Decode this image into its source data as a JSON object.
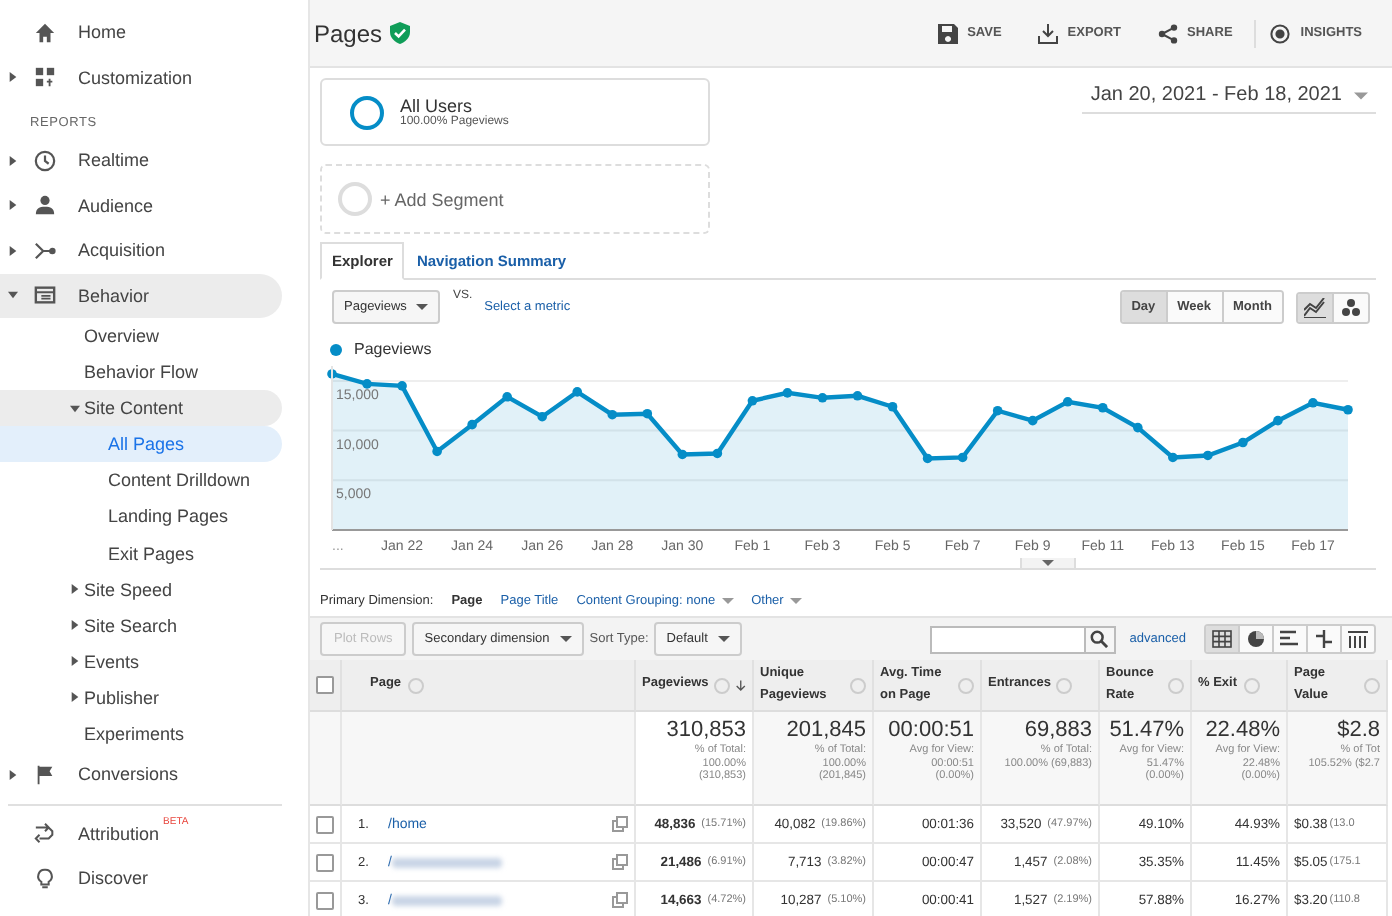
{
  "sidebar": {
    "top_items": [
      {
        "label": "Home",
        "kind": "home",
        "selected": false
      },
      {
        "label": "Customization",
        "kind": "dashboard",
        "expanded": false,
        "selected": false
      }
    ],
    "section_title": "REPORTS",
    "items": [
      {
        "label": "Realtime",
        "kind": "clock",
        "expanded": false,
        "selected": false
      },
      {
        "label": "Audience",
        "kind": "person",
        "expanded": false,
        "selected": false
      },
      {
        "label": "Acquisition",
        "kind": "branch",
        "expanded": false,
        "selected": false
      },
      {
        "label": "Behavior",
        "kind": "window",
        "expanded": true,
        "selected": false,
        "children": [
          {
            "label": "Overview",
            "selected": false
          },
          {
            "label": "Behavior Flow",
            "selected": false
          },
          {
            "label": "Site Content",
            "expanded": true,
            "selected": false,
            "children": [
              {
                "label": "All Pages",
                "selected": true
              },
              {
                "label": "Content Drilldown",
                "selected": false
              },
              {
                "label": "Landing Pages",
                "selected": false
              },
              {
                "label": "Exit Pages",
                "selected": false
              }
            ]
          },
          {
            "label": "Site Speed",
            "expanded": false,
            "selected": false
          },
          {
            "label": "Site Search",
            "expanded": false,
            "selected": false
          },
          {
            "label": "Events",
            "expanded": false,
            "selected": false
          },
          {
            "label": "Publisher",
            "expanded": false,
            "selected": false
          },
          {
            "label": "Experiments",
            "selected": false
          }
        ]
      },
      {
        "label": "Conversions",
        "kind": "flag",
        "expanded": false,
        "selected": false
      }
    ],
    "bottom_items": [
      {
        "label": "Attribution",
        "kind": "attribution",
        "badge": "BETA",
        "selected": false
      },
      {
        "label": "Discover",
        "kind": "bulb",
        "selected": false
      }
    ]
  },
  "header": {
    "title": "Pages",
    "actions": [
      {
        "label": "SAVE",
        "kind": "save"
      },
      {
        "label": "EXPORT",
        "kind": "export"
      },
      {
        "label": "SHARE",
        "kind": "share"
      },
      {
        "label": "INSIGHTS",
        "kind": "insights"
      }
    ]
  },
  "segments": [
    {
      "name": "All Users",
      "detail": "100.00% Pageviews"
    }
  ],
  "add_segment": "+ Add Segment",
  "date_range": "Jan 20, 2021 - Feb 18, 2021",
  "tabs": [
    {
      "label": "Explorer",
      "selected": true
    },
    {
      "label": "Navigation Summary",
      "selected": false
    }
  ],
  "metric_select": "Pageviews",
  "vs": "VS.",
  "select_metric": "Select a metric",
  "periods": [
    {
      "label": "Day",
      "selected": true
    },
    {
      "label": "Week",
      "selected": false
    },
    {
      "label": "Month",
      "selected": false
    }
  ],
  "chart_types": [
    {
      "kind": "line",
      "selected": true
    },
    {
      "kind": "motion",
      "selected": false
    }
  ],
  "chart": {
    "more": "...",
    "chart_data": {
      "type": "area",
      "grid": true,
      "categories": [
        null,
        null,
        "Jan 22",
        null,
        "Jan 24",
        null,
        "Jan 26",
        null,
        "Jan 28",
        null,
        "Jan 30",
        null,
        "Feb 1",
        null,
        "Feb 3",
        null,
        "Feb 5",
        null,
        "Feb 7",
        null,
        "Feb 9",
        null,
        "Feb 11",
        null,
        "Feb 13",
        null,
        "Feb 15",
        null,
        "Feb 17",
        null
      ],
      "series": [
        {
          "name": "Pageviews",
          "color": "#058dc7",
          "values": [
            15700,
            14700,
            14500,
            7900,
            10600,
            13400,
            11400,
            13900,
            11600,
            11700,
            7600,
            7700,
            13000,
            13800,
            13300,
            13500,
            12400,
            7200,
            7300,
            12000,
            11000,
            12900,
            12300,
            10300,
            7300,
            7500,
            8800,
            11000,
            12800,
            12100
          ]
        }
      ],
      "ylim": [
        0,
        16500
      ],
      "yticks": [
        {
          "value": 5000,
          "label": "5,000"
        },
        {
          "value": 10000,
          "label": "10,000"
        },
        {
          "value": 15000,
          "label": "15,000"
        }
      ]
    }
  },
  "primary_dimension": {
    "label": "Primary Dimension:",
    "options": [
      {
        "label": "Page",
        "selected": true,
        "dropdown": false
      },
      {
        "label": "Page Title",
        "selected": false,
        "dropdown": false
      },
      {
        "label": "Content Grouping: none",
        "selected": false,
        "dropdown": true
      },
      {
        "label": "Other",
        "selected": false,
        "dropdown": true
      }
    ]
  },
  "table_toolbar": {
    "plot_rows": {
      "label": "Plot Rows",
      "disabled": true
    },
    "secondary_dimension": "Secondary dimension",
    "sort_label": "Sort Type:",
    "sort_value": "Default",
    "advanced": "advanced",
    "views": [
      {
        "kind": "table",
        "selected": true
      },
      {
        "kind": "pie",
        "selected": false
      },
      {
        "kind": "bars",
        "selected": false
      },
      {
        "kind": "comparison",
        "selected": false
      },
      {
        "kind": "pivot",
        "selected": false
      }
    ]
  },
  "table": {
    "select_all_checked": false,
    "columns": [
      {
        "label": "Page",
        "sorted": false
      },
      {
        "label": "Pageviews",
        "sorted": true
      },
      {
        "label": "Unique Pageviews",
        "sorted": false
      },
      {
        "label": "Avg. Time on Page",
        "sorted": false
      },
      {
        "label": "Entrances",
        "sorted": false
      },
      {
        "label": "Bounce Rate",
        "sorted": false
      },
      {
        "label": "% Exit",
        "sorted": false
      },
      {
        "label": "Page Value",
        "sorted": false
      }
    ],
    "totals": [
      {
        "value": "310,853",
        "sub": [
          "% of Total:",
          "100.00%",
          "(310,853)"
        ]
      },
      {
        "value": "201,845",
        "sub": [
          "% of Total:",
          "100.00%",
          "(201,845)"
        ]
      },
      {
        "value": "00:00:51",
        "sub": [
          "Avg for View:",
          "00:00:51",
          "(0.00%)"
        ]
      },
      {
        "value": "69,883",
        "sub": [
          "% of Total:",
          "100.00% (69,883)"
        ]
      },
      {
        "value": "51.47%",
        "sub": [
          "Avg for View:",
          "51.47%",
          "(0.00%)"
        ]
      },
      {
        "value": "22.48%",
        "sub": [
          "Avg for View:",
          "22.48%",
          "(0.00%)"
        ]
      },
      {
        "value": "$2.8",
        "sub": [
          "% of Tot",
          "105.52% ($2.7"
        ]
      }
    ],
    "rows": [
      {
        "checked": false,
        "cells": [
          {
            "index": "1.",
            "value": "/home"
          },
          {
            "value": "48,836",
            "pct": "(15.71%)"
          },
          {
            "value": "40,082",
            "pct": "(19.86%)"
          },
          {
            "value": "00:01:36"
          },
          {
            "value": "33,520",
            "pct": "(47.97%)"
          },
          {
            "value": "49.10%"
          },
          {
            "value": "44.93%"
          },
          {
            "value": "$0.38",
            "pct": "(13.0"
          }
        ]
      },
      {
        "checked": false,
        "cells": [
          {
            "index": "2.",
            "value": "/"
          },
          {
            "value": "21,486",
            "pct": "(6.91%)"
          },
          {
            "value": "7,713",
            "pct": "(3.82%)"
          },
          {
            "value": "00:00:47"
          },
          {
            "value": "1,457",
            "pct": "(2.08%)"
          },
          {
            "value": "35.35%"
          },
          {
            "value": "11.45%"
          },
          {
            "value": "$5.05",
            "pct": "(175.1"
          }
        ]
      },
      {
        "checked": false,
        "cells": [
          {
            "index": "3.",
            "value": "/"
          },
          {
            "value": "14,663",
            "pct": "(4.72%)"
          },
          {
            "value": "10,287",
            "pct": "(5.10%)"
          },
          {
            "value": "00:00:41"
          },
          {
            "value": "1,527",
            "pct": "(2.19%)"
          },
          {
            "value": "57.88%"
          },
          {
            "value": "16.27%"
          },
          {
            "value": "$3.20",
            "pct": "(110.8"
          }
        ]
      }
    ]
  }
}
